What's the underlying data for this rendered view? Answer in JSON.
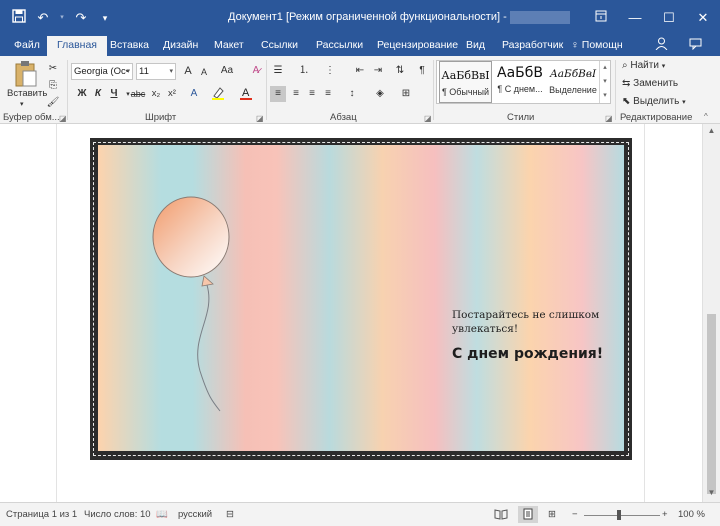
{
  "app": {
    "title": "Документ1 [Режим ограниченной функциональности] - Word",
    "accent": "#2b579a"
  },
  "qat": {
    "save_icon": "save-icon",
    "undo_icon": "undo-icon",
    "redo_icon": "redo-icon",
    "customize_icon": "customize-qat-icon"
  },
  "window": {
    "ribbon_options_icon": "ribbon-display-icon",
    "minimize": "—",
    "maximize": "☐",
    "close": "✕"
  },
  "tabs": [
    {
      "label": "Файл"
    },
    {
      "label": "Главная"
    },
    {
      "label": "Вставка"
    },
    {
      "label": "Дизайн"
    },
    {
      "label": "Макет"
    },
    {
      "label": "Ссылки"
    },
    {
      "label": "Рассылки"
    },
    {
      "label": "Рецензирование"
    },
    {
      "label": "Вид"
    },
    {
      "label": "Разработчик"
    },
    {
      "label": "Помощн"
    }
  ],
  "ribbon": {
    "clipboard": {
      "paste_label": "Вставить",
      "group_label": "Буфер обм..."
    },
    "font": {
      "font_name": "Georgia (Ос•",
      "font_size": "11",
      "bold": "Ж",
      "italic": "К",
      "underline": "Ч",
      "strike": "abc",
      "subscript": "x₂",
      "superscript": "x²",
      "grow": "A",
      "shrink": "A",
      "case": "Aa",
      "group_label": "Шрифт"
    },
    "paragraph": {
      "group_label": "Абзац"
    },
    "styles": {
      "items": [
        {
          "sample": "АаБбВвI",
          "name": "¶ Обычный"
        },
        {
          "sample": "АаБбВ",
          "name": "¶ С днем..."
        },
        {
          "sample": "АаБбВвI",
          "name": "Выделение"
        }
      ],
      "group_label": "Стили"
    },
    "editing": {
      "find": "Найти",
      "replace": "Заменить",
      "select": "Выделить",
      "group_label": "Редактирование"
    }
  },
  "document": {
    "line1": "Постарайтесь не слишком увлекаться!",
    "line2": "С днем рождения!"
  },
  "status": {
    "page": "Страница 1 из 1",
    "words": "Число слов: 10",
    "language": "русский",
    "zoom": "100 %",
    "zoom_percent": 100
  }
}
